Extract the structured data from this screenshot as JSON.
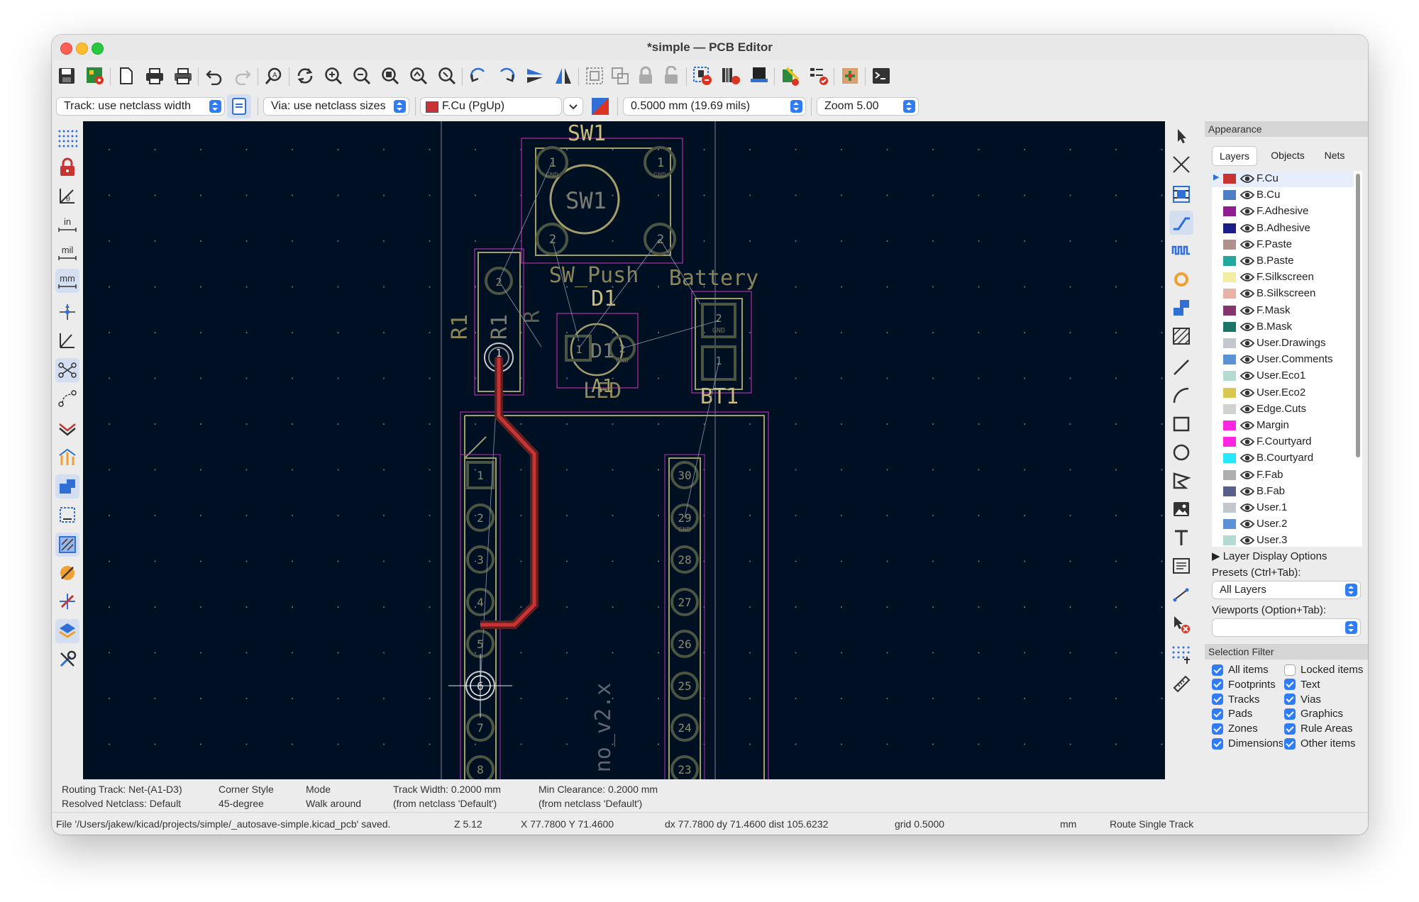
{
  "window": {
    "title": "*simple — PCB Editor"
  },
  "toolbar": {
    "icons": [
      "save-icon",
      "board-setup-icon",
      "page-settings-icon",
      "print-icon",
      "plot-icon",
      "undo-icon",
      "redo-icon",
      "find-icon",
      "redraw-icon",
      "zoom-in-icon",
      "zoom-out-icon",
      "zoom-fit-icon",
      "zoom-objects-icon",
      "zoom-selection-icon",
      "rotate-ccw-icon",
      "rotate-cw-icon",
      "mirror-v-icon",
      "mirror-h-icon",
      "group-icon",
      "ungroup-icon",
      "lock-icon",
      "unlock-icon",
      "netlist-update-icon",
      "drc-icon",
      "3d-viewer-icon",
      "footprint-editor-icon",
      "board-check-icon",
      "python-scripting-icon",
      "terminal-icon"
    ]
  },
  "options": {
    "track_width": "Track: use netclass width",
    "via_size": "Via: use netclass sizes",
    "active_layer": "F.Cu (PgUp)",
    "active_layer_color": "#c83434",
    "grid": "0.5000 mm (19.69 mils)",
    "zoom": "Zoom 5.00"
  },
  "left_toolbar": {
    "items": [
      "grid-icon",
      "lock-pads-icon",
      "polar-coords-icon",
      "unit-inch-icon",
      "unit-mil-icon",
      "unit-mm-icon",
      "cursor-icon",
      "angle-icon",
      "ratsnest-icon",
      "curved-ratsnest-icon",
      "netnames-icon",
      "high-contrast-icon",
      "pad-outline-icon",
      "via-outline-icon",
      "zone-fill-icon",
      "highlight-net-icon",
      "interactive-router-icon",
      "layers-manager-icon",
      "tools-icon"
    ],
    "unit_labels": {
      "in": "in",
      "mil": "mil",
      "mm": "mm"
    }
  },
  "pcb": {
    "labels": {
      "sw1_top": "SW1",
      "sw1_body": "SW1",
      "sw_push": "SW_Push",
      "battery": "Battery",
      "d1": "D1",
      "d1_body": "D1",
      "led": "LED",
      "a1": "A1",
      "bt1": "BT1",
      "r1_left": "R1",
      "r1_mid": "R1",
      "r": "R",
      "board_name": "no_v2.x",
      "gnd": "GND"
    },
    "left_pins": [
      "1",
      "2",
      "3",
      "4",
      "5",
      "6",
      "7",
      "8"
    ],
    "right_pins": [
      "30",
      "29",
      "28",
      "27",
      "26",
      "25",
      "24",
      "23"
    ],
    "r1_pins": [
      "2",
      "1"
    ],
    "sw1_pins": [
      "1",
      "1",
      "2",
      "2"
    ],
    "bt1_pins": [
      "2",
      "1"
    ],
    "d1_pins": [
      "1",
      "2"
    ]
  },
  "right_toolbar": {
    "items": [
      "select-icon",
      "local-ratsnest-icon",
      "add-footprint-icon",
      "route-track-icon",
      "tune-length-icon",
      "add-via-icon",
      "add-zone-icon",
      "add-rule-area-icon",
      "draw-line-icon",
      "draw-arc-icon",
      "draw-rectangle-icon",
      "draw-circle-icon",
      "draw-polygon-icon",
      "add-image-icon",
      "add-text-icon",
      "add-textbox-icon",
      "add-dimension-icon",
      "delete-tool-icon",
      "grid-origin-icon",
      "measure-icon"
    ]
  },
  "appearance": {
    "header": "Appearance",
    "tabs": [
      "Layers",
      "Objects",
      "Nets"
    ],
    "layers": [
      {
        "name": "F.Cu",
        "color": "#c83434"
      },
      {
        "name": "B.Cu",
        "color": "#4d7fc4"
      },
      {
        "name": "F.Adhesive",
        "color": "#8f1d8f"
      },
      {
        "name": "B.Adhesive",
        "color": "#1d1d8a"
      },
      {
        "name": "F.Paste",
        "color": "#b0908c"
      },
      {
        "name": "B.Paste",
        "color": "#23a8a0"
      },
      {
        "name": "F.Silkscreen",
        "color": "#f2eda1"
      },
      {
        "name": "B.Silkscreen",
        "color": "#e8b2a7"
      },
      {
        "name": "F.Mask",
        "color": "#84356e"
      },
      {
        "name": "B.Mask",
        "color": "#1c7467"
      },
      {
        "name": "User.Drawings",
        "color": "#c2c8ce"
      },
      {
        "name": "User.Comments",
        "color": "#5b92d6"
      },
      {
        "name": "User.Eco1",
        "color": "#b4dbd2"
      },
      {
        "name": "User.Eco2",
        "color": "#d8c850"
      },
      {
        "name": "Edge.Cuts",
        "color": "#d0d2cd"
      },
      {
        "name": "Margin",
        "color": "#ff26e2"
      },
      {
        "name": "F.Courtyard",
        "color": "#ff26e2"
      },
      {
        "name": "B.Courtyard",
        "color": "#26e9ff"
      },
      {
        "name": "F.Fab",
        "color": "#afafaf"
      },
      {
        "name": "B.Fab",
        "color": "#58608a"
      },
      {
        "name": "User.1",
        "color": "#c2c8ce"
      },
      {
        "name": "User.2",
        "color": "#5b92d6"
      },
      {
        "name": "User.3",
        "color": "#b4dbd2"
      }
    ],
    "layer_display_options": "Layer Display Options",
    "presets_label": "Presets (Ctrl+Tab):",
    "presets_value": "All Layers",
    "viewports_label": "Viewports (Option+Tab):",
    "viewports_value": ""
  },
  "selection_filter": {
    "header": "Selection Filter",
    "items": [
      {
        "label": "All items",
        "checked": true
      },
      {
        "label": "Locked items",
        "checked": false
      },
      {
        "label": "Footprints",
        "checked": true
      },
      {
        "label": "Text",
        "checked": true
      },
      {
        "label": "Tracks",
        "checked": true
      },
      {
        "label": "Vias",
        "checked": true
      },
      {
        "label": "Pads",
        "checked": true
      },
      {
        "label": "Graphics",
        "checked": true
      },
      {
        "label": "Zones",
        "checked": true
      },
      {
        "label": "Rule Areas",
        "checked": true
      },
      {
        "label": "Dimensions",
        "checked": true
      },
      {
        "label": "Other items",
        "checked": true
      }
    ]
  },
  "message_panel": {
    "routing_track": "Routing Track: Net-(A1-D3)",
    "resolved_netclass": "Resolved Netclass: Default",
    "corner_style_label": "Corner Style",
    "corner_style_value": "45-degree",
    "mode_label": "Mode",
    "mode_value": "Walk around",
    "track_width": "Track Width: 0.2000 mm",
    "track_width_src": "(from netclass 'Default')",
    "min_clearance": "Min Clearance: 0.2000 mm",
    "min_clearance_src": "(from netclass 'Default')"
  },
  "status": {
    "file_msg": "File '/Users/jakew/kicad/projects/simple/_autosave-simple.kicad_pcb' saved.",
    "zoom": "Z 5.12",
    "coords": "X 77.7800  Y 71.4600",
    "delta": "dx 77.7800  dy 71.4600  dist 105.6232",
    "grid": "grid 0.5000",
    "units": "mm",
    "tool": "Route Single Track"
  }
}
